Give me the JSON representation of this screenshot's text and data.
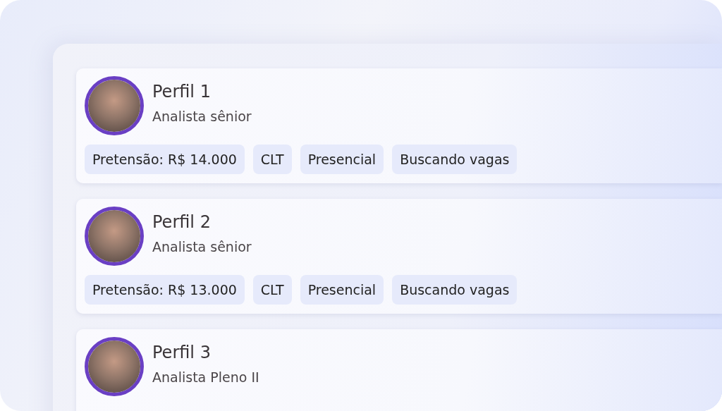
{
  "profiles": [
    {
      "name": "Perfil 1",
      "role": "Analista sênior",
      "tags": [
        "Pretensão: R$ 14.000",
        "CLT",
        "Presencial",
        "Buscando vagas"
      ]
    },
    {
      "name": "Perfil 2",
      "role": "Analista sênior",
      "tags": [
        "Pretensão: R$ 13.000",
        "CLT",
        "Presencial",
        "Buscando vagas"
      ]
    },
    {
      "name": "Perfil 3",
      "role": "Analista Pleno II"
    }
  ]
}
